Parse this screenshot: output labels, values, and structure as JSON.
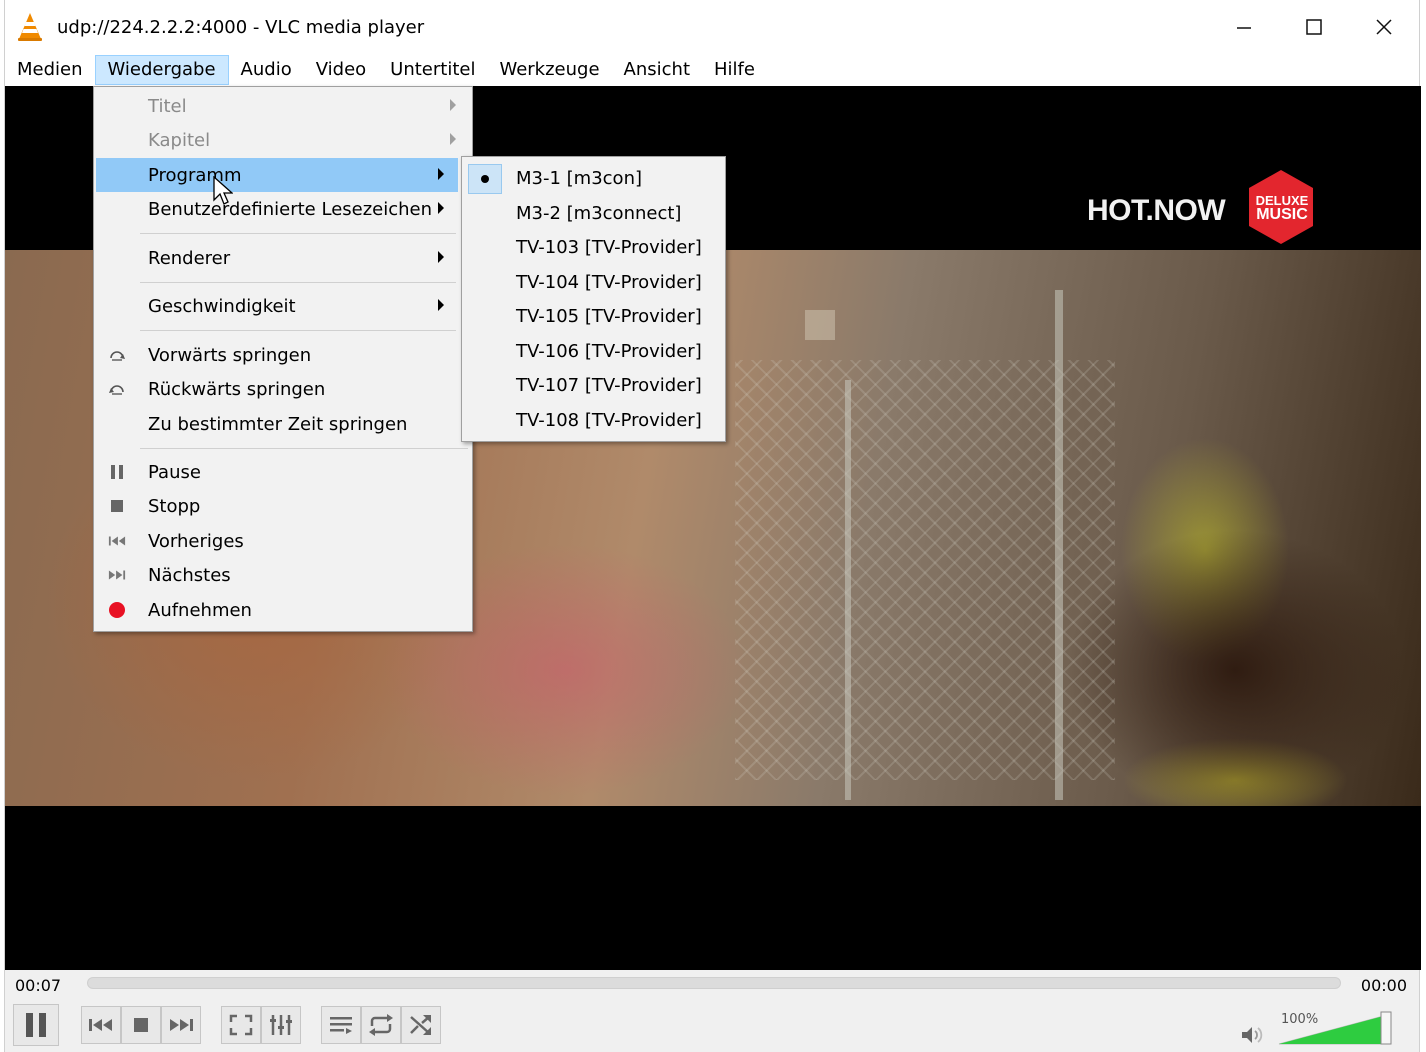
{
  "window": {
    "title": "udp://224.2.2.2:4000 - VLC media player",
    "controls": {
      "minimize": "—",
      "maximize": "☐",
      "close": "✕"
    }
  },
  "menubar": {
    "items": [
      {
        "label": "Medien"
      },
      {
        "label": "Wiedergabe",
        "active": true
      },
      {
        "label": "Audio"
      },
      {
        "label": "Video"
      },
      {
        "label": "Untertitel"
      },
      {
        "label": "Werkzeuge"
      },
      {
        "label": "Ansicht"
      },
      {
        "label": "Hilfe"
      }
    ]
  },
  "playback_menu": {
    "items": [
      {
        "label": "Titel",
        "disabled": true,
        "submenu": true
      },
      {
        "label": "Kapitel",
        "disabled": true,
        "submenu": true
      },
      {
        "label": "Programm",
        "highlighted": true,
        "submenu": true
      },
      {
        "label": "Benutzerdefinierte Lesezeichen",
        "submenu": true
      },
      {
        "label": "Renderer",
        "submenu": true
      },
      {
        "label": "Geschwindigkeit",
        "submenu": true
      },
      {
        "label": "Vorwärts springen",
        "icon": "jump-forward-icon"
      },
      {
        "label": "Rückwärts springen",
        "icon": "jump-backward-icon"
      },
      {
        "label": "Zu bestimmter Zeit springen"
      },
      {
        "label": "Pause",
        "icon": "pause-icon"
      },
      {
        "label": "Stopp",
        "icon": "stop-icon"
      },
      {
        "label": "Vorheriges",
        "icon": "previous-icon"
      },
      {
        "label": "Nächstes",
        "icon": "next-icon"
      },
      {
        "label": "Aufnehmen",
        "icon": "record-icon"
      }
    ]
  },
  "program_submenu": {
    "items": [
      {
        "label": "M3-1 [m3con]",
        "selected": true
      },
      {
        "label": "M3-2 [m3connect]"
      },
      {
        "label": "TV-103 [TV-Provider]"
      },
      {
        "label": "TV-104 [TV-Provider]"
      },
      {
        "label": "TV-105 [TV-Provider]"
      },
      {
        "label": "TV-106 [TV-Provider]"
      },
      {
        "label": "TV-107 [TV-Provider]"
      },
      {
        "label": "TV-108 [TV-Provider]"
      }
    ]
  },
  "video": {
    "channel_logo_text": "HOT.NOW",
    "badge_line1": "DELUXE",
    "badge_line2": "MUSIC"
  },
  "player": {
    "elapsed": "00:07",
    "remaining": "00:00",
    "volume_label": "100%",
    "volume_level_percent": 100
  },
  "colors": {
    "menu_highlight": "#91c9f7",
    "active_menu": "#cce8ff",
    "record_red": "#e81123",
    "volume_green": "#2ecc40",
    "vlc_orange": "#f08a00"
  }
}
